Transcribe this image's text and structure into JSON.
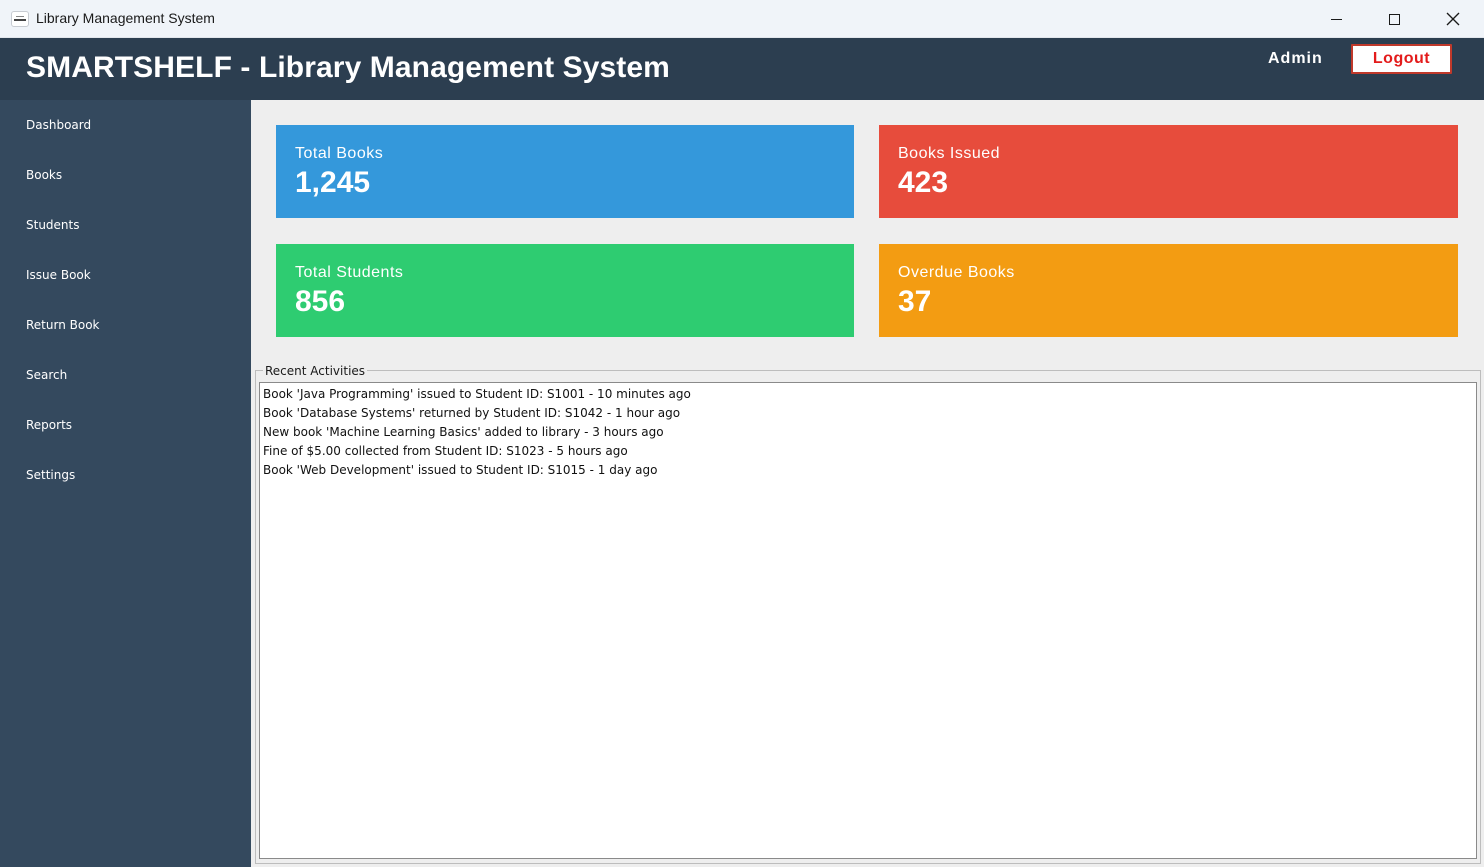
{
  "window": {
    "title": "Library Management System"
  },
  "header": {
    "title": "SMARTSHELF - Library Management System",
    "user": "Admin",
    "logout_label": "Logout"
  },
  "sidebar": {
    "items": [
      {
        "label": "Dashboard"
      },
      {
        "label": "Books"
      },
      {
        "label": "Students"
      },
      {
        "label": "Issue Book"
      },
      {
        "label": "Return Book"
      },
      {
        "label": "Search"
      },
      {
        "label": "Reports"
      },
      {
        "label": "Settings"
      }
    ]
  },
  "stats": {
    "total_books": {
      "label": "Total Books",
      "value": "1,245",
      "color": "#3498db"
    },
    "books_issued": {
      "label": "Books Issued",
      "value": "423",
      "color": "#e74c3c"
    },
    "total_students": {
      "label": "Total Students",
      "value": "856",
      "color": "#2ecc71"
    },
    "overdue_books": {
      "label": "Overdue Books",
      "value": "37",
      "color": "#f39c12"
    }
  },
  "activities": {
    "title": "Recent Activities",
    "lines": [
      "Book 'Java Programming' issued to Student ID: S1001 - 10 minutes ago",
      "Book 'Database Systems' returned by Student ID: S1042 - 1 hour ago",
      "New book 'Machine Learning Basics' added to library - 3 hours ago",
      "Fine of $5.00 collected from Student ID: S1023 - 5 hours ago",
      "Book 'Web Development' issued to Student ID: S1015 - 1 day ago"
    ]
  },
  "colors": {
    "header_bg": "#2c3e50",
    "sidebar_bg": "#34495e",
    "main_bg": "#eeeeee",
    "logout_text": "#e31b1b"
  }
}
